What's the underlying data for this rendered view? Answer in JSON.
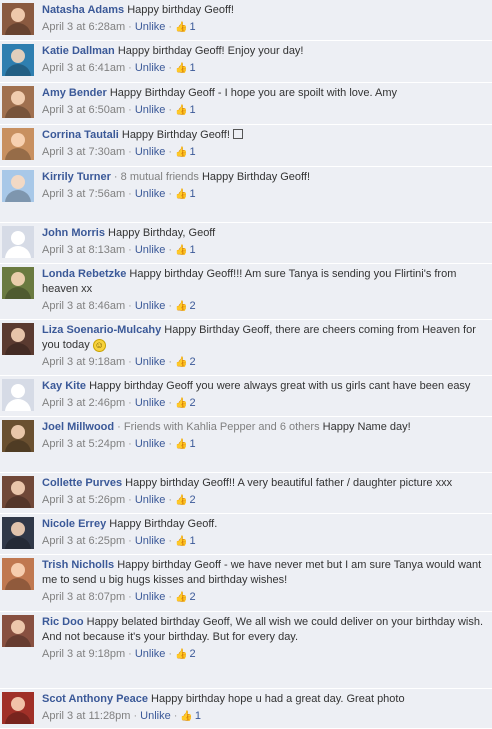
{
  "comments": [
    {
      "author": "Natasha Adams",
      "note": "",
      "text": "Happy birthday Geoff!",
      "time": "April 3 at 6:28am",
      "action": "Unlike",
      "likes": "1",
      "avatar": "#8a5a40",
      "h": 41
    },
    {
      "author": "Katie Dallman",
      "note": "",
      "text": "Happy birthday Geoff! Enjoy your day!",
      "time": "April 3 at 6:41am",
      "action": "Unlike",
      "likes": "1",
      "avatar": "#2f7fb0",
      "h": 42
    },
    {
      "author": "Amy Bender",
      "note": "",
      "text": "Happy Birthday Geoff - I hope you are spoilt with love. Amy",
      "time": "April 3 at 6:50am",
      "action": "Unlike",
      "likes": "1",
      "avatar": "#a0704f",
      "h": 42
    },
    {
      "author": "Corrina Tautali",
      "note": "",
      "text": "Happy Birthday Geoff!",
      "glyph": true,
      "time": "April 3 at 7:30am",
      "action": "Unlike",
      "likes": "1",
      "avatar": "#c89060",
      "h": 42
    },
    {
      "author": "Kirrily Turner",
      "note": " · 8 mutual friends",
      "text": "Happy Birthday Geoff!",
      "time": "April 3 at 7:56am",
      "action": "Unlike",
      "likes": "1",
      "avatar": "#a8c8e8",
      "h": 56
    },
    {
      "author": "John Morris",
      "note": "",
      "text": "Happy Birthday, Geoff",
      "time": "April 3 at 8:13am",
      "action": "Unlike",
      "likes": "1",
      "avatar": "#c8ccd8",
      "h": 41
    },
    {
      "author": "Londa Rebetzke",
      "note": "",
      "text": "Happy birthday Geoff!!! Am sure Tanya is sending you Flirtini's from heaven xx",
      "time": "April 3 at 8:46am",
      "action": "Unlike",
      "likes": "2",
      "avatar": "#6a7a40",
      "h": 56
    },
    {
      "author": "Liza Soenario-Mulcahy",
      "note": "",
      "text": "Happy Birthday Geoff, there are cheers coming from Heaven for you today",
      "emoji": true,
      "time": "April 3 at 9:18am",
      "action": "Unlike",
      "likes": "2",
      "avatar": "#5a3a30",
      "h": 56
    },
    {
      "author": "Kay Kite",
      "note": "",
      "text": "Happy birthday Geoff you were always great with us girls cant have been easy",
      "time": "April 3 at 2:46pm",
      "action": "Unlike",
      "likes": "2",
      "avatar": "#c8ccd8",
      "h": 41
    },
    {
      "author": "Joel Millwood",
      "note": " · Friends with Kahlia Pepper and 6 others",
      "text": "Happy Name day!",
      "time": "April 3 at 5:24pm",
      "action": "Unlike",
      "likes": "1",
      "avatar": "#6a5030",
      "h": 56
    },
    {
      "author": "Collette Purves",
      "note": "",
      "text": "Happy birthday Geoff!! A very beautiful father / daughter picture xxx",
      "time": "April 3 at 5:26pm",
      "action": "Unlike",
      "likes": "2",
      "avatar": "#704838",
      "h": 41
    },
    {
      "author": "Nicole Errey",
      "note": "",
      "text": "Happy Birthday Geoff.",
      "time": "April 3 at 6:25pm",
      "action": "Unlike",
      "likes": "1",
      "avatar": "#303848",
      "h": 41
    },
    {
      "author": "Trish Nicholls",
      "note": "",
      "text": "Happy birthday Geoff - we have never met but I am sure Tanya would want me to send u big hugs kisses and birthday wishes!",
      "time": "April 3 at 8:07pm",
      "action": "Unlike",
      "likes": "2",
      "avatar": "#c07850",
      "h": 57
    },
    {
      "author": "Ric Doo",
      "note": "",
      "text": "Happy belated birthday Geoff, We all wish we could deliver on your birthday wish. And not because it's your birthday. But for every day.",
      "time": "April 3 at 9:18pm",
      "action": "Unlike",
      "likes": "2",
      "avatar": "#885040",
      "h": 77
    },
    {
      "author": "Scot Anthony Peace",
      "note": "",
      "text": "Happy birthday hope u had a great day. Great photo",
      "time": "April 3 at 11:28pm",
      "action": "Unlike",
      "likes": "1",
      "avatar": "#a03028",
      "h": 40
    }
  ]
}
